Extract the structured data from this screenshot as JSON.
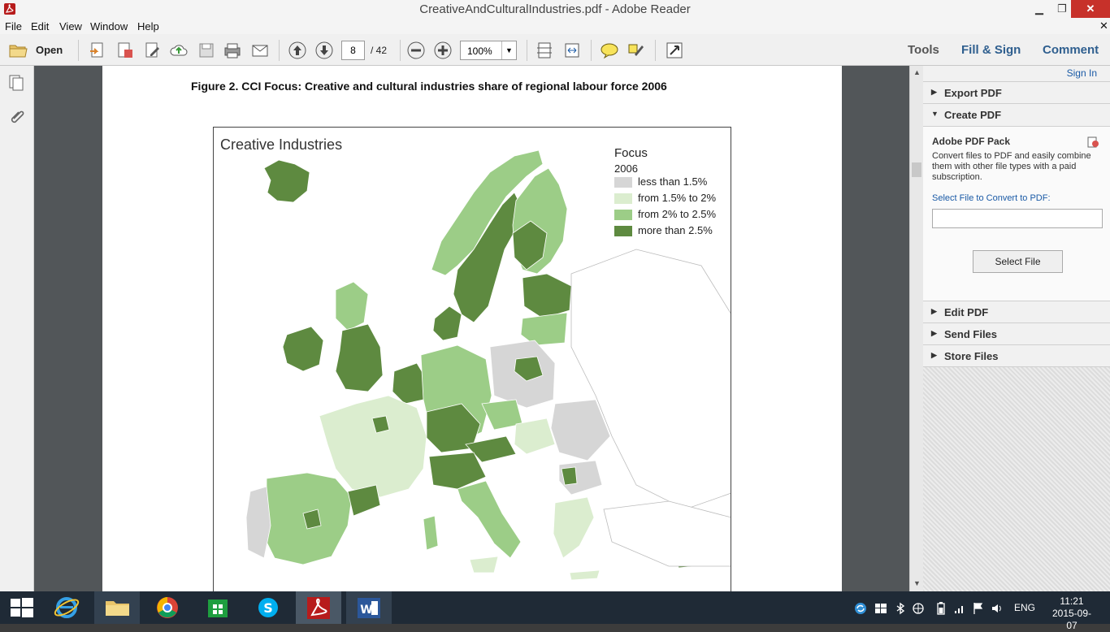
{
  "window": {
    "title": "CreativeAndCulturalIndustries.pdf - Adobe Reader",
    "min_glyph": "▁",
    "max_glyph": "❐",
    "close_glyph": "✕"
  },
  "menu": {
    "file": "File",
    "edit": "Edit",
    "view": "View",
    "window": "Window",
    "help": "Help",
    "close_glyph": "✕"
  },
  "toolbar": {
    "open_label": "Open",
    "page_current": "8",
    "page_total": "/ 42",
    "zoom": "100%",
    "zoom_arrow": "▼",
    "tabs": {
      "tools": "Tools",
      "fill_sign": "Fill & Sign",
      "comment": "Comment"
    }
  },
  "document": {
    "figure_caption": "Figure 2.  CCI Focus: Creative and cultural industries share of regional labour force 2006",
    "map": {
      "title": "Creative Industries",
      "legend_title": "Focus",
      "legend_year": "2006",
      "legend": [
        {
          "label": "less than 1.5%",
          "color": "#d6d6d6"
        },
        {
          "label": "from 1.5% to 2%",
          "color": "#dbedcf"
        },
        {
          "label": "from 2% to 2.5%",
          "color": "#9ccd87"
        },
        {
          "label": "more than 2.5%",
          "color": "#5e8a40"
        }
      ]
    }
  },
  "scrollbar": {
    "up": "▲",
    "down": "▼"
  },
  "right_pane": {
    "sign_in": "Sign In",
    "export_pdf": "Export PDF",
    "create_pdf": "Create PDF",
    "pack_title": "Adobe PDF Pack",
    "pack_desc": "Convert files to PDF and easily combine them with other file types with a paid subscription.",
    "select_prompt": "Select File to Convert to PDF:",
    "select_button": "Select File",
    "edit_pdf": "Edit PDF",
    "send_files": "Send Files",
    "store_files": "Store Files",
    "collapsed_glyph": "▶",
    "expanded_glyph": "▼"
  },
  "taskbar": {
    "lang": "ENG",
    "time": "11:21",
    "date": "2015-09-07"
  },
  "colors": {
    "accent": "#2f5f8f",
    "link": "#1a5aa6",
    "close_red": "#c7312a",
    "reader_red": "#b71c1c"
  }
}
